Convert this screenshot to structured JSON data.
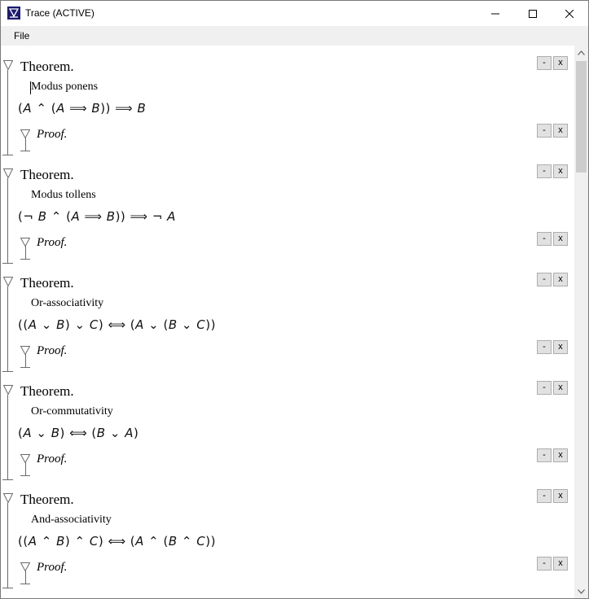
{
  "window": {
    "title": "Trace (ACTIVE)",
    "icon": "trace-app-icon"
  },
  "menu": {
    "file_label": "File"
  },
  "buttons": {
    "minus_label": "-",
    "close_label": "x"
  },
  "theorems": [
    {
      "heading": "Theorem.",
      "name": "Modus ponens",
      "proof_label": "Proof."
    },
    {
      "heading": "Theorem.",
      "name": "Modus tollens",
      "proof_label": "Proof."
    },
    {
      "heading": "Theorem.",
      "name": "Or-associativity",
      "proof_label": "Proof."
    },
    {
      "heading": "Theorem.",
      "name": "Or-commutativity",
      "proof_label": "Proof."
    },
    {
      "heading": "Theorem.",
      "name": "And-associativity",
      "proof_label": "Proof."
    }
  ],
  "formulas": [
    [
      "(",
      "A",
      " ⌃ (",
      "A",
      " ⟹ ",
      "B",
      ")) ⟹ ",
      "B"
    ],
    [
      "(¬ ",
      "B",
      " ⌃ (",
      "A",
      " ⟹ ",
      "B",
      ")) ⟹ ¬ ",
      "A"
    ],
    [
      "((",
      "A",
      " ⌄ ",
      "B",
      ") ⌄ ",
      "C",
      ") ⟺ (",
      "A",
      " ⌄ (",
      "B",
      " ⌄ ",
      "C",
      "))"
    ],
    [
      "(",
      "A",
      " ⌄ ",
      "B",
      ") ⟺ (",
      "B",
      " ⌄ ",
      "A",
      ")"
    ],
    [
      "((",
      "A",
      " ⌃ ",
      "B",
      ") ⌃ ",
      "C",
      ") ⟺ (",
      "A",
      " ⌃ (",
      "B",
      " ⌃ ",
      "C",
      "))"
    ]
  ]
}
